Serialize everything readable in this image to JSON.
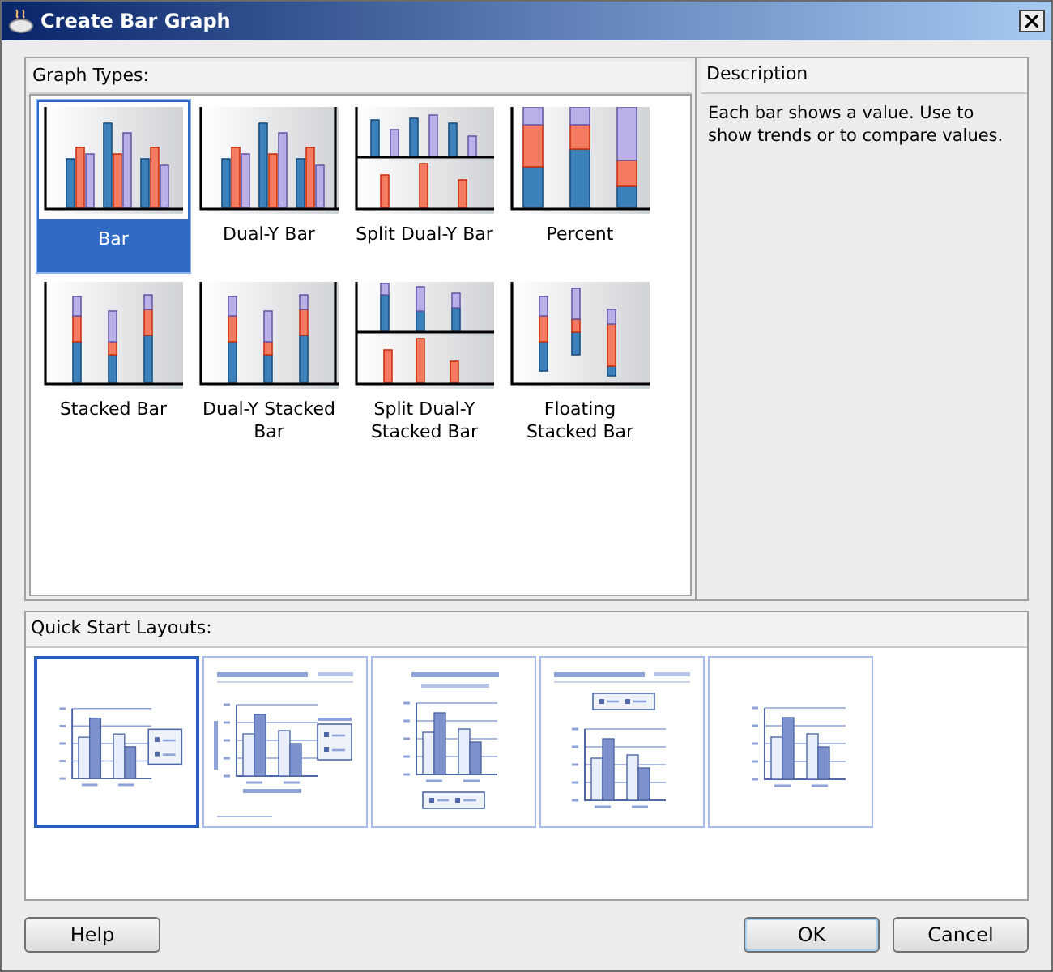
{
  "window": {
    "title": "Create Bar Graph"
  },
  "graph_types": {
    "heading": "Graph Types:",
    "items": [
      {
        "kind": "bar",
        "label": "Bar",
        "selected": true
      },
      {
        "kind": "dual_y_bar",
        "label": "Dual-Y Bar",
        "selected": false
      },
      {
        "kind": "split_dual_y_bar",
        "label": "Split Dual-Y Bar",
        "selected": false
      },
      {
        "kind": "percent",
        "label": "Percent",
        "selected": false
      },
      {
        "kind": "stacked_bar",
        "label": "Stacked Bar",
        "selected": false
      },
      {
        "kind": "dual_y_stacked_bar",
        "label": "Dual-Y Stacked Bar",
        "selected": false
      },
      {
        "kind": "split_dual_y_stacked_bar",
        "label": "Split Dual-Y Stacked Bar",
        "selected": false
      },
      {
        "kind": "floating_stacked_bar",
        "label": "Floating Stacked Bar",
        "selected": false
      }
    ]
  },
  "description": {
    "heading": "Description",
    "text": "Each bar shows a value. Use to show trends or to compare values."
  },
  "quick_start_layouts": {
    "heading": "Quick Start Layouts:",
    "items": [
      {
        "kind": "legend_right",
        "selected": true
      },
      {
        "kind": "titles_legend_right",
        "selected": false
      },
      {
        "kind": "titles_legend_bottom",
        "selected": false
      },
      {
        "kind": "title_legend_top",
        "selected": false
      },
      {
        "kind": "chart_only",
        "selected": false
      }
    ]
  },
  "buttons": {
    "help": "Help",
    "ok": "OK",
    "cancel": "Cancel"
  }
}
